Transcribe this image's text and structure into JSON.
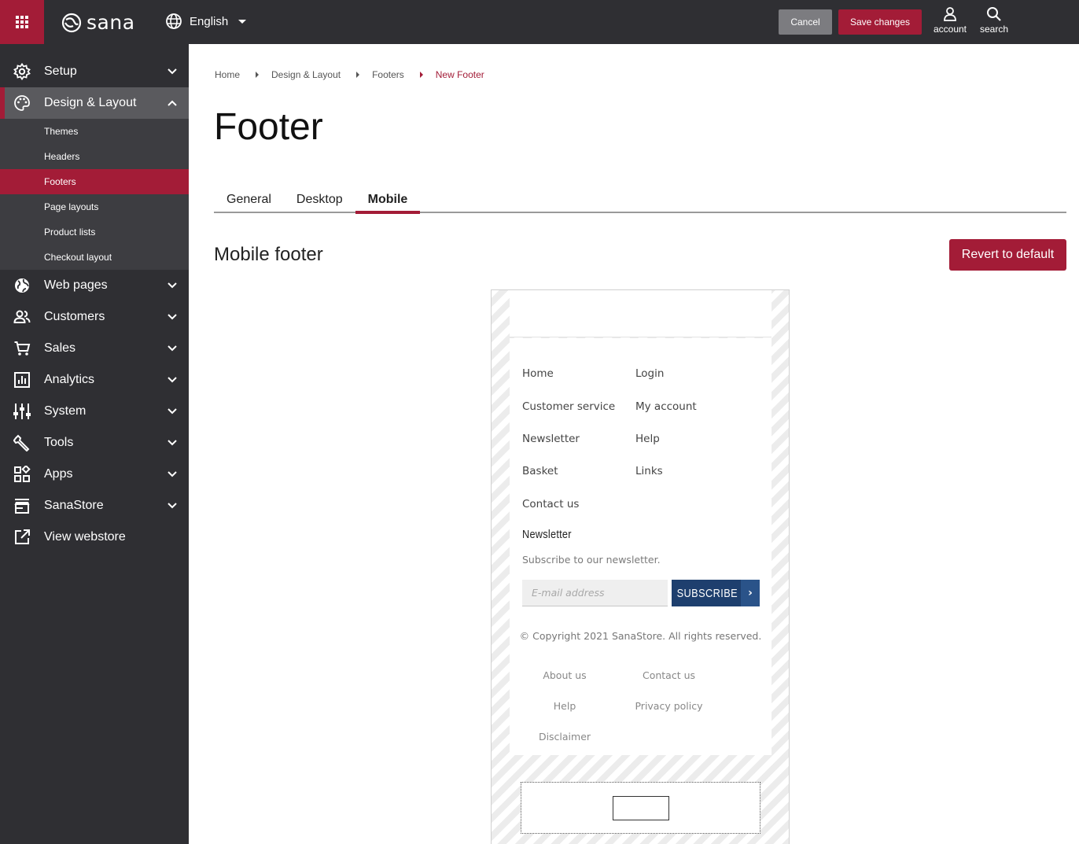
{
  "topbar": {
    "logo": "sana",
    "language": "English",
    "cancel_label": "Cancel",
    "save_label": "Save changes",
    "account_label": "account",
    "search_label": "search"
  },
  "sidebar": {
    "items": [
      {
        "label": "Setup",
        "icon": "gear-icon"
      },
      {
        "label": "Design & Layout",
        "icon": "palette-icon",
        "expanded": true
      },
      {
        "label": "Web pages",
        "icon": "globe-icon"
      },
      {
        "label": "Customers",
        "icon": "people-icon"
      },
      {
        "label": "Sales",
        "icon": "cart-icon"
      },
      {
        "label": "Analytics",
        "icon": "chart-icon"
      },
      {
        "label": "System",
        "icon": "sliders-icon"
      },
      {
        "label": "Tools",
        "icon": "wrench-icon"
      },
      {
        "label": "Apps",
        "icon": "apps-icon"
      },
      {
        "label": "SanaStore",
        "icon": "store-icon"
      },
      {
        "label": "View webstore",
        "icon": "external-link-icon"
      }
    ],
    "subitems": [
      "Themes",
      "Headers",
      "Footers",
      "Page layouts",
      "Product lists",
      "Checkout layout"
    ],
    "selected_subitem": "Footers"
  },
  "breadcrumb": [
    "Home",
    "Design & Layout",
    "Footers",
    "New Footer"
  ],
  "page_title": "Footer",
  "tabs": [
    "General",
    "Desktop",
    "Mobile"
  ],
  "active_tab": "Mobile",
  "section_title": "Mobile footer",
  "revert_label": "Revert to default",
  "preview": {
    "links_left": [
      "Home",
      "Customer service",
      "Newsletter",
      "Basket",
      "Contact us"
    ],
    "links_right": [
      "Login",
      "My account",
      "Help",
      "Links"
    ],
    "newsletter_title": "Newsletter",
    "newsletter_subtitle": "Subscribe to our newsletter.",
    "email_placeholder": "E-mail address",
    "subscribe_label": "SUBSCRIBE",
    "subscribe_arrow": "›",
    "copyright": "© Copyright 2021 SanaStore. All rights reserved.",
    "bottom_links": [
      "About us",
      "Contact us",
      "Help",
      "Privacy policy",
      "Disclaimer"
    ]
  },
  "colors": {
    "brand": "#a31c37",
    "dark": "#2f2f33",
    "subscribe": "#1e3f6e"
  }
}
